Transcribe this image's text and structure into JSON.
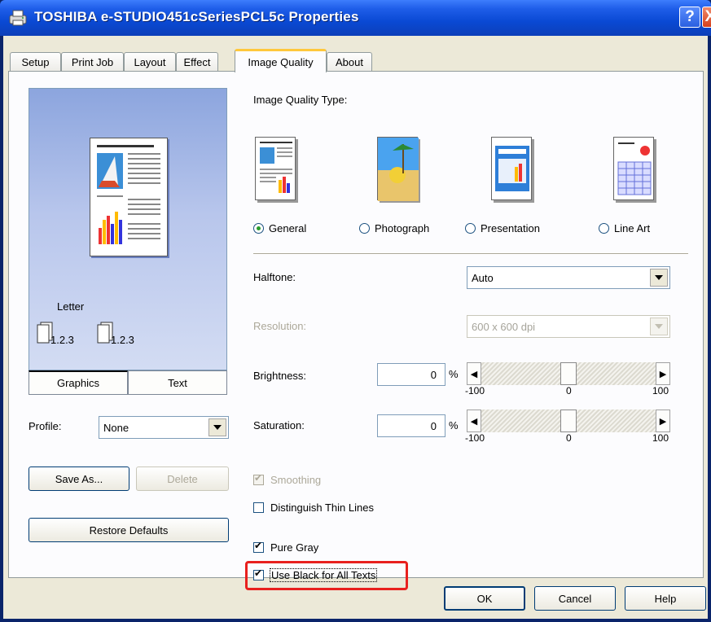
{
  "window": {
    "title": "TOSHIBA e-STUDIO451cSeriesPCL5c Properties",
    "help_button": "?",
    "close_button": "X"
  },
  "tabs": [
    {
      "label": "Setup"
    },
    {
      "label": "Print Job"
    },
    {
      "label": "Layout"
    },
    {
      "label": "Effect"
    },
    {
      "label": "Image Quality",
      "active": true
    },
    {
      "label": "About"
    }
  ],
  "preview": {
    "paper_label": "Letter",
    "copy_label_1": "1.2.3",
    "copy_label_2": "1.2.3",
    "graphics_button": "Graphics",
    "text_button": "Text"
  },
  "profile": {
    "label": "Profile:",
    "value": "None",
    "save_as": "Save As...",
    "delete": "Delete",
    "restore_defaults": "Restore Defaults"
  },
  "image_quality": {
    "type_label": "Image Quality Type:",
    "types": [
      {
        "label": "General",
        "checked": true,
        "icon": "general-doc-icon"
      },
      {
        "label": "Photograph",
        "checked": false,
        "icon": "photo-icon"
      },
      {
        "label": "Presentation",
        "checked": false,
        "icon": "presentation-icon"
      },
      {
        "label": "Line Art",
        "checked": false,
        "icon": "line-art-icon"
      }
    ],
    "halftone": {
      "label": "Halftone:",
      "value": "Auto"
    },
    "resolution": {
      "label": "Resolution:",
      "value": "600 x 600 dpi",
      "disabled": true
    },
    "brightness": {
      "label": "Brightness:",
      "value": "0",
      "unit": "%",
      "min": "-100",
      "mid": "0",
      "max": "100",
      "level": 0
    },
    "saturation": {
      "label": "Saturation:",
      "value": "0",
      "unit": "%",
      "min": "-100",
      "mid": "0",
      "max": "100",
      "level": 0
    },
    "smoothing": {
      "label": "Smoothing",
      "checked": true,
      "disabled": true
    },
    "distinguish_thin_lines": {
      "label": "Distinguish Thin Lines",
      "checked": false
    },
    "pure_gray": {
      "label": "Pure Gray",
      "checked": true
    },
    "use_black_for_all_texts": {
      "label": "Use Black for All Texts",
      "checked": true
    }
  },
  "footer": {
    "ok": "OK",
    "cancel": "Cancel",
    "help": "Help"
  },
  "colors": {
    "titlebar": "#0a49d4",
    "dialog_bg": "#ece9d8",
    "highlight": "#e8201e",
    "tab_active_accent": "#ffc83c"
  }
}
